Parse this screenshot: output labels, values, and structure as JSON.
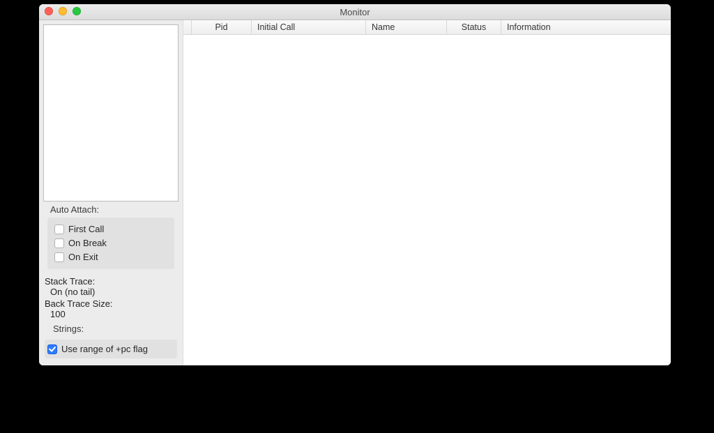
{
  "window": {
    "title": "Monitor"
  },
  "sidebar": {
    "auto_attach_label": "Auto Attach:",
    "attach": {
      "first_call": {
        "label": "First Call",
        "checked": false
      },
      "on_break": {
        "label": "On Break",
        "checked": false
      },
      "on_exit": {
        "label": "On Exit",
        "checked": false
      }
    },
    "stack_trace": {
      "label": "Stack Trace:",
      "value": "On (no tail)"
    },
    "back_trace": {
      "label": "Back Trace Size:",
      "value": "100"
    },
    "strings_label": "Strings:",
    "use_pc_flag": {
      "label": "Use range of +pc flag",
      "checked": true
    }
  },
  "table": {
    "columns": {
      "pid": "Pid",
      "initial_call": "Initial Call",
      "name": "Name",
      "status": "Status",
      "information": "Information"
    }
  }
}
